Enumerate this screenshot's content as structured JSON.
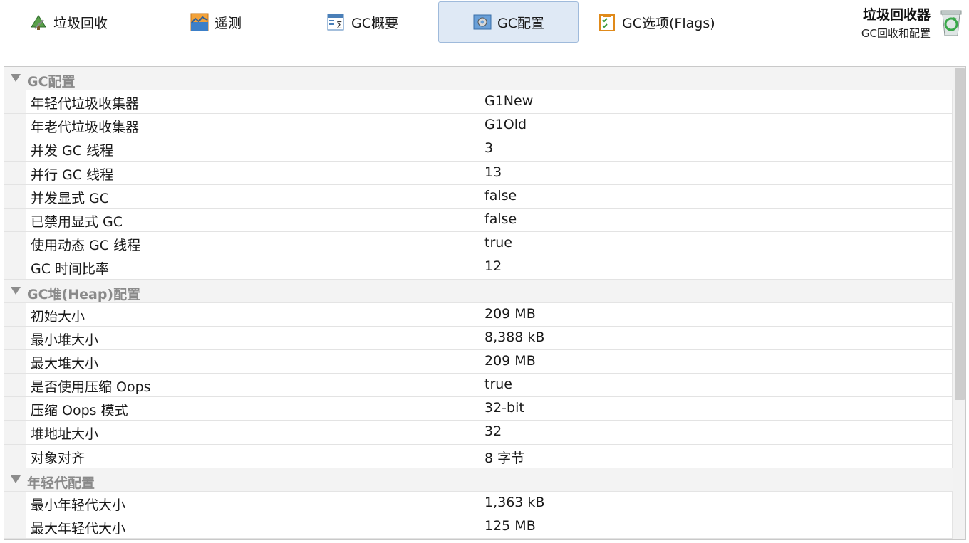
{
  "tabs": [
    {
      "label": "垃圾回收",
      "icon": "gc-tree-icon",
      "active": false
    },
    {
      "label": "遥测",
      "icon": "telemetry-chart-icon",
      "active": false
    },
    {
      "label": "GC概要",
      "icon": "summary-table-icon",
      "active": false
    },
    {
      "label": "GC配置",
      "icon": "gear-icon",
      "active": true
    },
    {
      "label": "GC选项(Flags)",
      "icon": "clipboard-check-icon",
      "active": false
    }
  ],
  "header": {
    "title": "垃圾回收器",
    "subtitle": "GC回收和配置",
    "icon": "recycle-bin-icon"
  },
  "groups": [
    {
      "name": "GC配置",
      "rows": [
        {
          "key": "年轻代垃圾收集器",
          "value": "G1New"
        },
        {
          "key": "年老代垃圾收集器",
          "value": "G1Old"
        },
        {
          "key": "并发 GC 线程",
          "value": "3"
        },
        {
          "key": "并行 GC 线程",
          "value": "13"
        },
        {
          "key": "并发显式 GC",
          "value": "false"
        },
        {
          "key": "已禁用显式 GC",
          "value": "false"
        },
        {
          "key": "使用动态 GC 线程",
          "value": "true"
        },
        {
          "key": "GC 时间比率",
          "value": "12"
        }
      ]
    },
    {
      "name": "GC堆(Heap)配置",
      "rows": [
        {
          "key": "初始大小",
          "value": "209 MB"
        },
        {
          "key": "最小堆大小",
          "value": "8,388 kB"
        },
        {
          "key": "最大堆大小",
          "value": "209 MB"
        },
        {
          "key": "是否使用压缩 Oops",
          "value": "true"
        },
        {
          "key": "压缩 Oops 模式",
          "value": "32-bit"
        },
        {
          "key": "堆地址大小",
          "value": "32"
        },
        {
          "key": "对象对齐",
          "value": "8 字节"
        }
      ]
    },
    {
      "name": "年轻代配置",
      "rows": [
        {
          "key": "最小年轻代大小",
          "value": "1,363 kB"
        },
        {
          "key": "最大年轻代大小",
          "value": "125 MB"
        }
      ]
    }
  ],
  "colors": {
    "active_tab_bg": "#dfe9f5",
    "active_tab_border": "#9fbadb",
    "group_text": "#8a8a8a"
  }
}
